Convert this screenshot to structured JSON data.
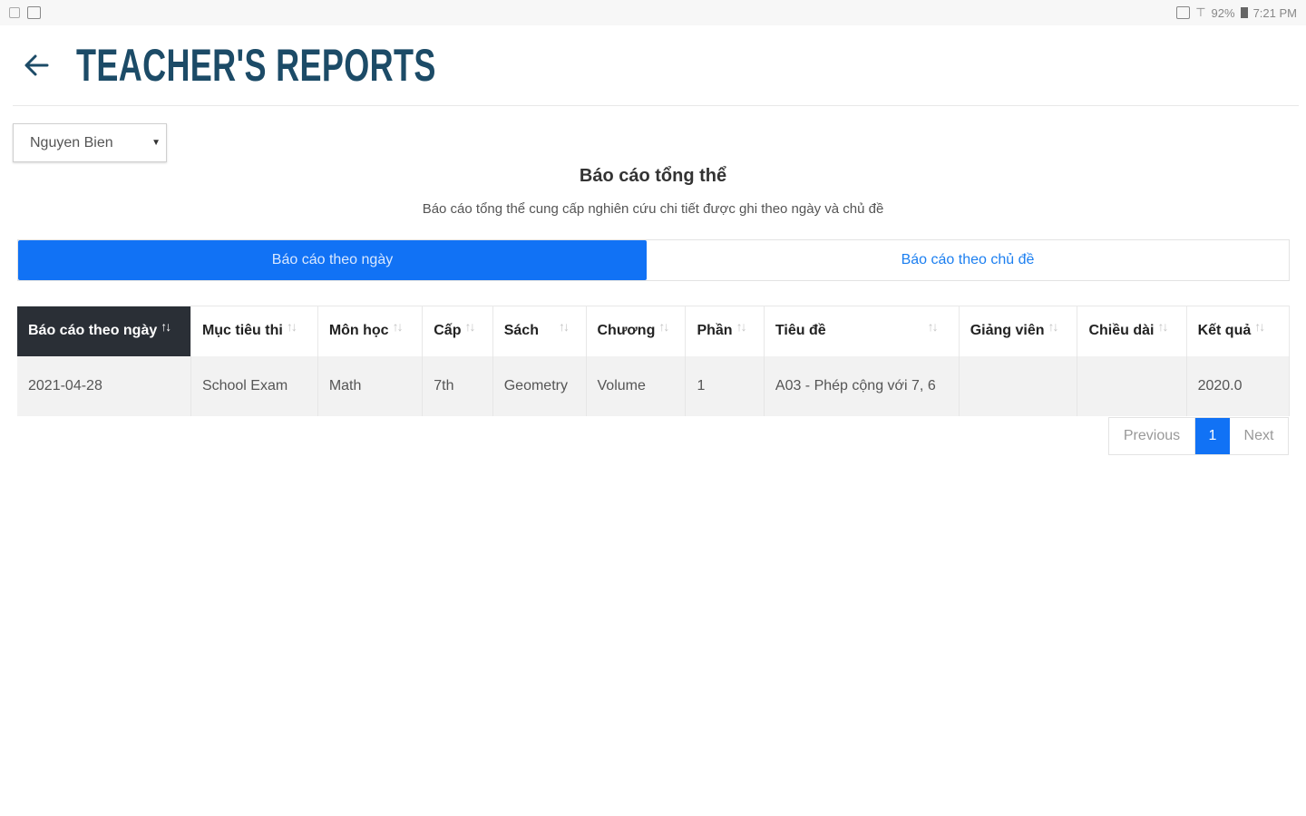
{
  "status_bar": {
    "battery": "92%",
    "time": "7:21 PM"
  },
  "header": {
    "title": "TEACHER'S REPORTS"
  },
  "teacher_select": {
    "value": "Nguyen Bien"
  },
  "section": {
    "title": "Báo cáo tổng thể",
    "description": "Báo cáo tổng thể cung cấp nghiên cứu chi tiết được ghi theo ngày và chủ đề"
  },
  "tabs": [
    {
      "label": "Báo cáo theo ngày",
      "active": true
    },
    {
      "label": "Báo cáo theo chủ đề",
      "active": false
    }
  ],
  "table": {
    "columns": [
      "Báo cáo theo ngày",
      "Mục tiêu thi",
      "Môn học",
      "Cấp",
      "Sách",
      "Chương",
      "Phần",
      "Tiêu đề",
      "Giảng viên",
      "Chiều dài",
      "Kết quả"
    ],
    "rows": [
      [
        "2021-04-28",
        "School Exam",
        "Math",
        "7th",
        "Geometry",
        "Volume",
        "1",
        "A03 - Phép cộng với 7, 6",
        "",
        "",
        "2020.0"
      ]
    ]
  },
  "pagination": {
    "previous": "Previous",
    "current": "1",
    "next": "Next"
  },
  "colors": {
    "accent": "#1172f5",
    "title": "#1c4b67",
    "sorted_header_bg": "#2a2f36"
  }
}
